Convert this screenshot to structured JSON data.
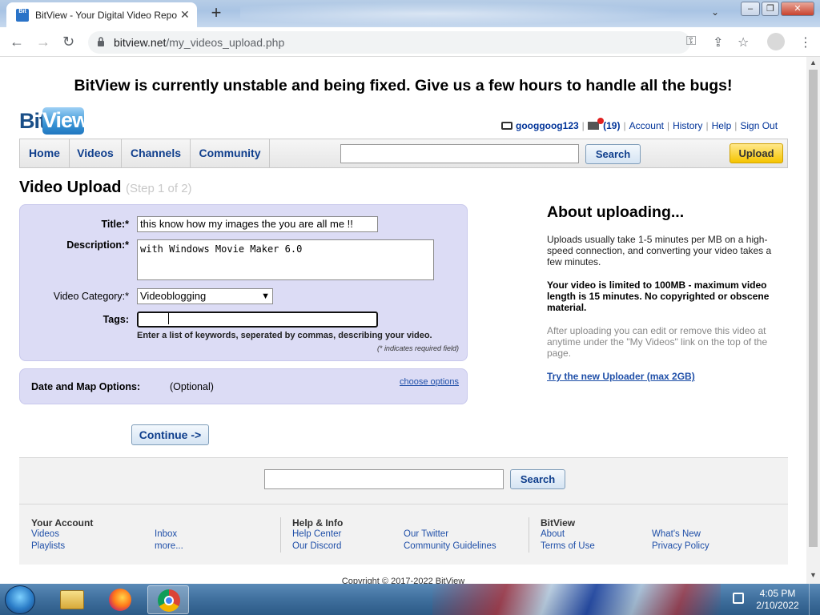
{
  "browser": {
    "tab_title": "BitView - Your Digital Video Repo",
    "favicon_text": "Bit",
    "url_domain": "bitview.net",
    "url_path": "/my_videos_upload.php"
  },
  "banner": "BitView is currently unstable and being fixed. Give us a few hours to handle all the bugs!",
  "logo": {
    "bit": "Bit",
    "view": "View"
  },
  "userbar": {
    "username": "googgoog123",
    "inbox_count": "(19)",
    "links": [
      "Account",
      "History",
      "Help",
      "Sign Out"
    ]
  },
  "nav": {
    "items": [
      "Home",
      "Videos",
      "Channels",
      "Community"
    ],
    "search_label": "Search",
    "upload_label": "Upload"
  },
  "page": {
    "title": "Video Upload",
    "step": "(Step 1 of 2)"
  },
  "form": {
    "title_label": "Title:*",
    "title_value": "this know how my images the you are all me !!",
    "description_label": "Description:*",
    "description_value": "with Windows Movie Maker 6.0",
    "category_label": "Video Category:*",
    "category_value": "Videoblogging",
    "tags_label": "Tags:",
    "tags_value": "",
    "tags_help": "Enter a list of keywords, seperated by commas, describing your video.",
    "required_note": "(* indicates required field)",
    "date_map_label": "Date and Map Options:",
    "date_map_optional": "(Optional)",
    "choose_options": "choose options",
    "continue_label": "Continue ->"
  },
  "about": {
    "heading": "About uploading...",
    "p1": "Uploads usually take 1-5 minutes per MB on a high-speed connection, and converting your video takes a few minutes.",
    "p2": "Your video is limited to 100MB - maximum video length is 15 minutes. No copyrighted or obscene material.",
    "p3": "After uploading you can edit or remove this video at anytime under the \"My Videos\" link on the top of the page.",
    "uploader_link": "Try the new Uploader (max 2GB)"
  },
  "footer": {
    "search_label": "Search",
    "your_account": {
      "heading": "Your Account",
      "links": [
        "Videos",
        "Inbox",
        "Playlists",
        "more..."
      ]
    },
    "help_info": {
      "heading": "Help & Info",
      "links": [
        "Help Center",
        "Our Twitter",
        "Our Discord",
        "Community Guidelines"
      ]
    },
    "bitview": {
      "heading": "BitView",
      "links": [
        "About",
        "What's New",
        "Terms of Use",
        "Privacy Policy"
      ]
    },
    "copyright": "Copyright © 2017-2022 BitView"
  },
  "taskbar": {
    "time": "4:05 PM",
    "date": "2/10/2022"
  },
  "colors": {
    "panel_bg": "#dcdcf5",
    "link": "#1f4fa8",
    "nav_text": "#0f3e8c",
    "upload_button": "#f5c400"
  }
}
